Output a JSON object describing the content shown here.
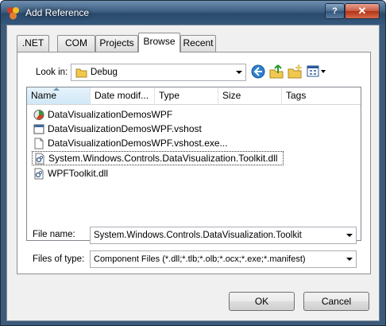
{
  "window": {
    "title": "Add Reference",
    "help_label": "?",
    "close_label": "✕"
  },
  "tabs": [
    {
      "label": ".NET"
    },
    {
      "label": "COM"
    },
    {
      "label": "Projects"
    },
    {
      "label": "Browse",
      "active": true
    },
    {
      "label": "Recent"
    }
  ],
  "browse": {
    "look_in_label": "Look in:",
    "look_in_value": "Debug",
    "columns": [
      "Name",
      "Date modif...",
      "Type",
      "Size",
      "Tags"
    ],
    "files": [
      {
        "name": "DataVisualizationDemosWPF",
        "icon": "application-icon"
      },
      {
        "name": "DataVisualizationDemosWPF.vshost",
        "icon": "window-app-icon"
      },
      {
        "name": "DataVisualizationDemosWPF.vshost.exe...",
        "icon": "blank-file-icon"
      },
      {
        "name": "System.Windows.Controls.DataVisualization.Toolkit.dll",
        "icon": "dll-file-icon",
        "selected": true
      },
      {
        "name": "WPFToolkit.dll",
        "icon": "dll-file-icon"
      }
    ]
  },
  "file_name": {
    "label": "File name:",
    "value": "System.Windows.Controls.DataVisualization.Toolkit"
  },
  "file_type": {
    "label": "Files of type:",
    "value": "Component Files (*.dll;*.tlb;*.olb;*.ocx;*.exe;*.manifest)"
  },
  "buttons": {
    "ok": "OK",
    "cancel": "Cancel"
  }
}
